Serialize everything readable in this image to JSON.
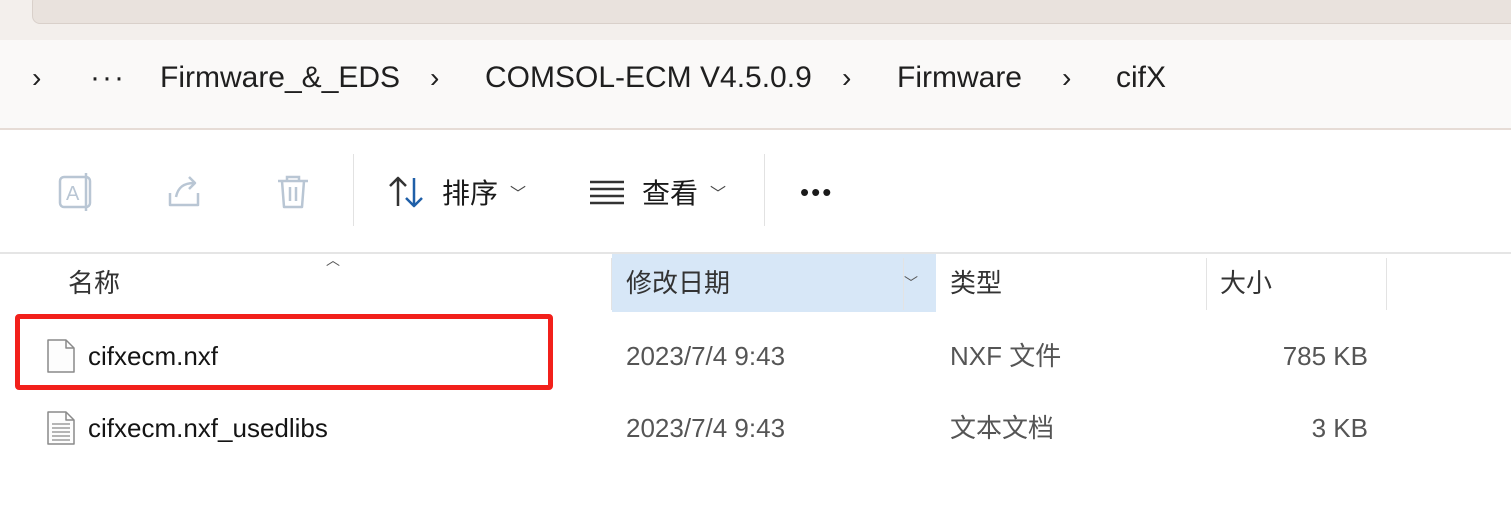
{
  "breadcrumb": {
    "overflow": "···",
    "items": [
      "Firmware_&_EDS",
      "COMSOL-ECM V4.5.0.9",
      "Firmware",
      "cifX"
    ],
    "separator": ">"
  },
  "toolbar": {
    "icons": [
      "rename-icon",
      "share-icon",
      "delete-icon"
    ],
    "sort_label": "排序",
    "view_label": "查看",
    "more_label": "•••"
  },
  "columns": {
    "name": "名称",
    "date": "修改日期",
    "type": "类型",
    "size": "大小"
  },
  "files": [
    {
      "name": "cifxecm.nxf",
      "date": "2023/7/4 9:43",
      "type": "NXF 文件",
      "size": "785 KB",
      "highlighted": true
    },
    {
      "name": "cifxecm.nxf_usedlibs",
      "date": "2023/7/4 9:43",
      "type": "文本文档",
      "size": "3 KB",
      "highlighted": false
    }
  ],
  "colors": {
    "highlight_border": "#f2201b",
    "sorted_column_bg": "#d7e7f7"
  }
}
